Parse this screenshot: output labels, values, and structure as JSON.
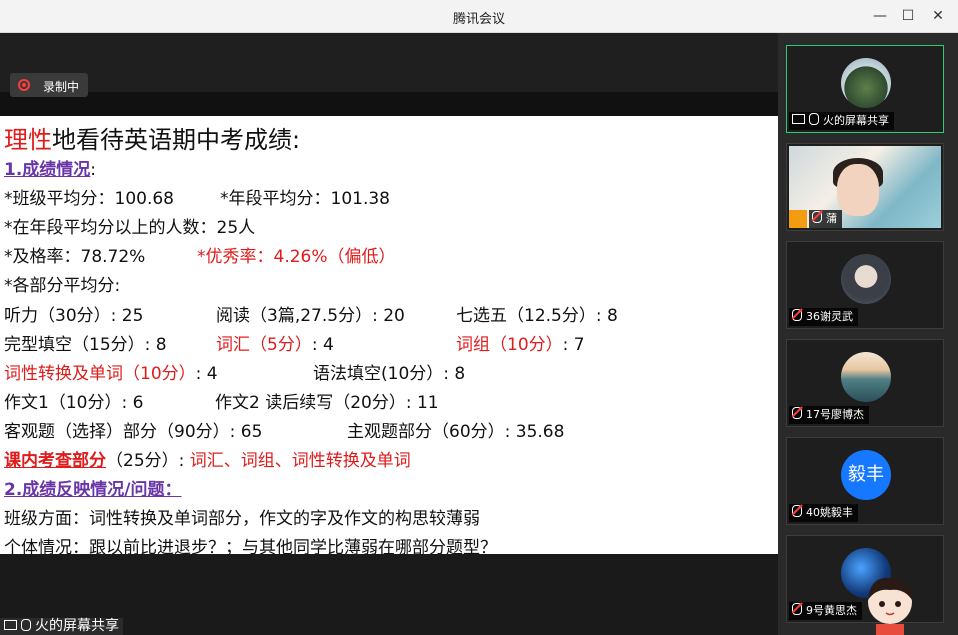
{
  "window": {
    "title": "腾讯会议",
    "controls": [
      "—",
      "☐",
      "✕"
    ]
  },
  "recording": {
    "label": "录制中"
  },
  "share": {
    "label": "火的屏幕共享"
  },
  "slide": {
    "title_red": "理性",
    "title_rest": "地看待英语期中考成绩:",
    "h1": "1.成绩情况",
    "h1_colon": ":",
    "class_avg": "*班级平均分：100.68",
    "grade_avg": "*年段平均分：101.38",
    "above_avg": "*在年段平均分以上的人数：25人",
    "pass_rate": "*及格率：78.72%",
    "excellent": "*优秀率：4.26%（偏低）",
    "parts_title": "*各部分平均分:",
    "row1": [
      "听力（30分）: 25",
      "阅读（3篇,27.5分）: 20",
      "七选五（12.5分）: 8"
    ],
    "row2a": "完型填空（15分）: 8",
    "row2b": "词汇（5分）",
    "row2b_val": ": 4",
    "row2c": "词组（10分）",
    "row2c_val": ": 7",
    "row3a": "词性转换及单词（10分）",
    "row3a_val": ": 4",
    "row3b": "语法填空(10分）: 8",
    "row4": [
      "作文1（10分）: 6",
      "作文2 读后续写（20分）: 11"
    ],
    "row5": [
      "客观题（选择）部分（90分）: 65",
      "主观题部分（60分）: 35.68"
    ],
    "exam_label": "课内考查部分",
    "exam_score": "（25分）:",
    "exam_items": "词汇、词组、词性转换及单词",
    "h2": "2.成绩反映情况/问题：",
    "class_issue": "班级方面：词性转换及单词部分，作文的字及作文的构思较薄弱",
    "individual": "个体情况：跟以前比进退步？；与其他同学比薄弱在哪部分题型？"
  },
  "participants": [
    {
      "name": "火的屏幕共享",
      "type": "screen"
    },
    {
      "name": "蒲",
      "type": "video"
    },
    {
      "name": "36谢灵武",
      "type": "avatar"
    },
    {
      "name": "17号廖博杰",
      "type": "avatar"
    },
    {
      "name": "40姚毅丰",
      "type": "initials",
      "initials": "毅丰"
    },
    {
      "name": "9号黄思杰",
      "type": "avatar"
    }
  ],
  "colors": {
    "accent_green": "#2ecc71",
    "red": "#e01b1b",
    "purple": "#6a35a6",
    "blue_avatar": "#1677ff"
  }
}
